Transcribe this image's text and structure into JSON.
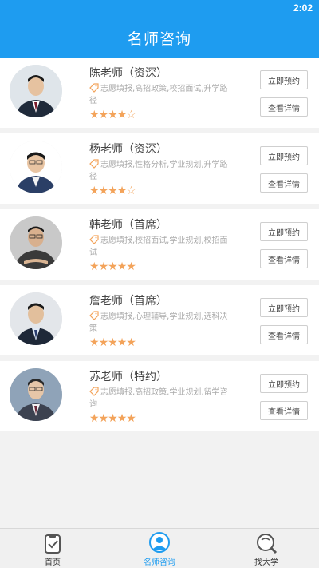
{
  "status_bar": {
    "time": "2:02"
  },
  "header": {
    "title": "名师咨询"
  },
  "colors": {
    "accent": "#1e9cf0",
    "star": "#f3a35a"
  },
  "teachers": [
    {
      "name": "陈老师（资深）",
      "tags": "志愿填报,高招政策,校招面试,升学路径",
      "rating": 4,
      "book_label": "立即预约",
      "detail_label": "查看详情"
    },
    {
      "name": "杨老师（资深）",
      "tags": "志愿填报,性格分析,学业规划,升学路径",
      "rating": 4,
      "book_label": "立即预约",
      "detail_label": "查看详情"
    },
    {
      "name": "韩老师（首席）",
      "tags": "志愿填报,校招面试,学业规划,校招面试",
      "rating": 5,
      "book_label": "立即预约",
      "detail_label": "查看详情"
    },
    {
      "name": "詹老师（首席）",
      "tags": "志愿填报,心理辅导,学业规划,选科决策",
      "rating": 5,
      "book_label": "立即预约",
      "detail_label": "查看详情"
    },
    {
      "name": "苏老师（特约）",
      "tags": "志愿填报,高招政策,学业规划,留学咨询",
      "rating": 5,
      "book_label": "立即预约",
      "detail_label": "查看详情"
    }
  ],
  "tab_bar": [
    {
      "label": "首页",
      "icon": "clipboard-icon",
      "active": false
    },
    {
      "label": "名师咨询",
      "icon": "consultant-icon",
      "active": true
    },
    {
      "label": "找大学",
      "icon": "search-icon",
      "active": false
    }
  ]
}
